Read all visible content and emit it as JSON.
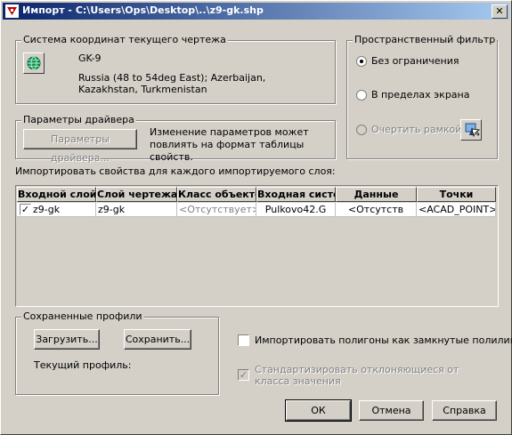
{
  "window": {
    "title": "Импорт - C:\\Users\\Ops\\Desktop\\..\\z9-gk.shp",
    "close_label": "✕"
  },
  "coord_system": {
    "legend": "Система координат текущего чертежа",
    "code": "GK-9",
    "description": "Russia (48 to 54deg East); Azerbaijan, Kazakhstan, Turkmenistan",
    "icon": "globe-icon"
  },
  "spatial_filter": {
    "legend": "Пространственный фильтр",
    "options": [
      {
        "label": "Без ограничения",
        "selected": true,
        "enabled": true
      },
      {
        "label": "В пределах экрана",
        "selected": false,
        "enabled": true
      },
      {
        "label": "Очертить рамкой",
        "selected": false,
        "enabled": false
      }
    ],
    "pick_icon": "pick-window-icon"
  },
  "driver": {
    "legend": "Параметры драйвера",
    "button_label": "Параметры драйвера...",
    "note": "Изменение параметров может повлиять на формат таблицы свойств."
  },
  "layers": {
    "caption": "Импортировать свойства для каждого импортируемого слоя:",
    "columns": [
      "Входной слой",
      "Слой чертежа",
      "Класс объекто",
      "Входная систе",
      "Данные",
      "Точки"
    ],
    "rows": [
      {
        "checked": true,
        "cells": [
          "z9-gk",
          "z9-gk",
          "<Отсутствует>",
          "Pulkovo42.G",
          "<Отсутств",
          "<ACAD_POINT>"
        ]
      }
    ]
  },
  "profiles": {
    "legend": "Сохраненные профили",
    "load_label": "Загрузить...",
    "save_label": "Сохранить...",
    "current_label": "Текущий профиль:"
  },
  "options": {
    "import_polygons": {
      "label": "Импортировать полигоны как замкнутые полилинии",
      "checked": false
    },
    "normalize": {
      "label": "Стандартизировать отклоняющиеся от класса значения",
      "checked": true,
      "enabled": false
    }
  },
  "buttons": {
    "ok": "ОК",
    "cancel": "Отмена",
    "help": "Справка"
  },
  "colors": {
    "titlebar_start": "#0a246a",
    "titlebar_end": "#a6caf0",
    "face": "#d4d0c8"
  }
}
